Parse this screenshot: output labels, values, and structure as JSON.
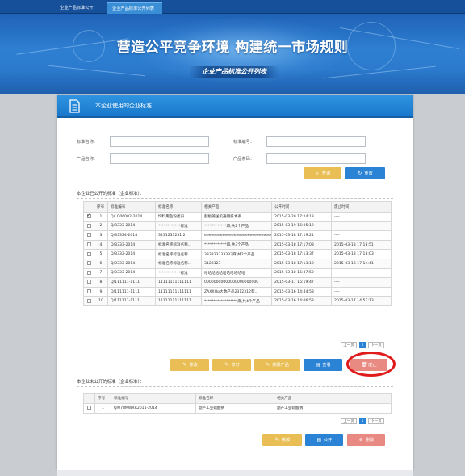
{
  "nav": {
    "tabs": [
      "企业产品标准公开",
      "企业产品标准公开列表"
    ],
    "active_index": 1
  },
  "banner": {
    "title": "营造公平竞争环境 构建统一市场规则",
    "subtitle": "企业产品标准公开列表"
  },
  "panel": {
    "title": "本企业使用的企业标准"
  },
  "search": {
    "standard_name_label": "标准名称：",
    "standard_no_label": "标准编号：",
    "product_name_label": "产品名称：",
    "product_code_label": "产品条码：",
    "standard_name_value": "",
    "standard_no_value": "",
    "product_name_value": "",
    "product_code_value": "",
    "query_label": "查询",
    "reset_label": "重置"
  },
  "public_section": {
    "title": "本企业已公开的标准（企业标准）：",
    "columns": [
      "",
      "序号",
      "标准编号",
      "标准名称",
      "相关产品",
      "公开时间",
      "废止时间"
    ],
    "rows": [
      {
        "checked": true,
        "no": "1",
        "code": "Q/LQ06002-2014",
        "name": "饲料用鱼粉蛋白",
        "product": "刮板输送机通用技术条",
        "public_time": "2015-03-20 17:24:13",
        "abolish_time": "----"
      },
      {
        "checked": false,
        "no": "2",
        "code": "Q/3333-2014",
        "name": "************标准",
        "product": "************麻,共2个产品",
        "public_time": "2015-03-19 16:05:12",
        "abolish_time": "----"
      },
      {
        "checked": false,
        "no": "3",
        "code": "Q/33334-2014",
        "name": "3231231231 2",
        "product": "eeeeeeeeeeeeeeeeeeeeeeeeeeeeee",
        "public_time": "2015-03-18 17:19:21",
        "abolish_time": "----"
      },
      {
        "checked": false,
        "no": "4",
        "code": "Q/3333-2014",
        "name": "标准名称标准名称...",
        "product": "************麻,共3个产品",
        "public_time": "2015-03-18 17:17:08",
        "abolish_time": "2015-03-18 17:18:51"
      },
      {
        "checked": false,
        "no": "5",
        "code": "Q/3333-2014",
        "name": "标准名称标准名称...",
        "product": "333333333333麻,共2个产品",
        "public_time": "2015-03-18 17:13:37",
        "abolish_time": "2015-03-18 17:18:03"
      },
      {
        "checked": false,
        "no": "6",
        "code": "Q/3333-2014",
        "name": "标准名称标准名称...",
        "product": "3123123",
        "public_time": "2015-03-18 17:13:10",
        "abolish_time": "2015-03-18 17:14:41"
      },
      {
        "checked": false,
        "no": "7",
        "code": "Q/3333-2014",
        "name": "************标准",
        "product": "哈哈哈哈哈哈哈哈哈哈哈",
        "public_time": "2015-03-18 15:37:50",
        "abolish_time": "----"
      },
      {
        "checked": false,
        "no": "8",
        "code": "Q/111111-1111",
        "name": "11111111111111",
        "product": "00000000000000000000000",
        "public_time": "2015-03-17 15:19:47",
        "abolish_time": "----"
      },
      {
        "checked": false,
        "no": "9",
        "code": "Q/111111-1111",
        "name": "11111111111111",
        "product": "ZAXXQp大数产品2312312客...",
        "public_time": "2015-03-16 14:44:58",
        "abolish_time": "----"
      },
      {
        "checked": false,
        "no": "10",
        "code": "Q/111111-1111",
        "name": "11111111111111",
        "product": "******************麻,共4个产品",
        "public_time": "2015-03-16 14:06:53",
        "abolish_time": "2015-03-17 14:52:13"
      }
    ],
    "pager": {
      "prev": "上一页",
      "current": "1",
      "next": "下一页"
    },
    "buttons": {
      "edit": "修改",
      "revise": "修订",
      "related": "关联产品",
      "view": "查看",
      "abolish": "废止"
    }
  },
  "private_section": {
    "title": "本企业未公开的标准（企业标准）：",
    "columns": [
      "",
      "序号",
      "标准编号",
      "标准名称",
      "相关产品"
    ],
    "rows": [
      {
        "checked": false,
        "no": "1",
        "code": "Q/078MWRR2011-2014",
        "name": "副产工业硫酸钠",
        "product": "副产工业硫酸钠"
      }
    ],
    "pager": {
      "prev": "上一页",
      "current": "1",
      "next": "下一页"
    },
    "buttons": {
      "edit": "修改",
      "publish": "公开",
      "delete": "删除"
    }
  },
  "colors": {
    "nav": "#17509a",
    "accent_blue": "#2a83d4",
    "button_yellow": "#e8be55",
    "button_red": "#e98a82",
    "highlight_ring": "#e01b1b"
  }
}
